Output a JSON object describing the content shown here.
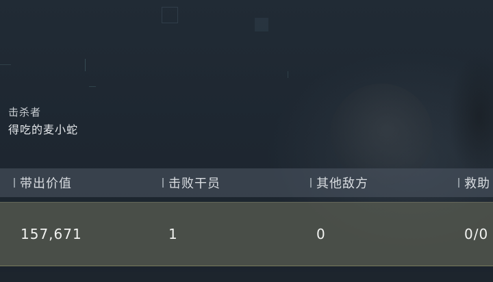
{
  "killer": {
    "label": "击杀者",
    "name": "得吃的麦小蛇"
  },
  "stats": {
    "headers": [
      "带出价值",
      "击败干员",
      "其他敌方",
      "救助"
    ],
    "values": [
      "157,671",
      "1",
      "0",
      "0/0"
    ]
  },
  "colors": {
    "background": "#1b232c",
    "header_bar": "#4e5864",
    "value_row": "#565a50",
    "value_row_border": "#a0a06e"
  }
}
